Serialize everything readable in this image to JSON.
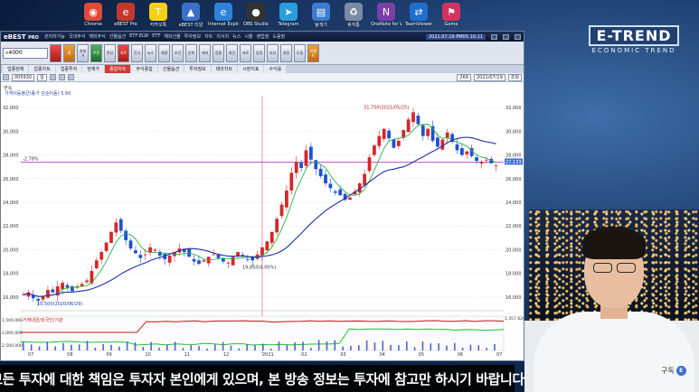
{
  "desktop": {
    "icons": [
      {
        "name": "chrome-icon",
        "label": "Chrome",
        "glyph": "◉",
        "color": "#e04a3a"
      },
      {
        "name": "ebest-icon",
        "label": "eBEST Pro",
        "glyph": "e",
        "color": "#c4382b"
      },
      {
        "name": "kakaotalk-icon",
        "label": "카카오톡",
        "glyph": "T",
        "color": "#f5d015"
      },
      {
        "name": "hts-icon",
        "label": "eBEST 티알",
        "glyph": "▲",
        "color": "#3c70c8"
      },
      {
        "name": "ie-icon",
        "label": "Internet Explorer",
        "glyph": "e",
        "color": "#2f83d8"
      },
      {
        "name": "obs-icon",
        "label": "OBS Studio",
        "glyph": "●",
        "color": "#333333"
      },
      {
        "name": "telegram-icon",
        "label": "Telegram",
        "glyph": "➤",
        "color": "#2a9ddb"
      },
      {
        "name": "folder-icon",
        "label": "탐색기",
        "glyph": "▤",
        "color": "#3c7bd0"
      },
      {
        "name": "recycle-icon",
        "label": "휴지통",
        "glyph": "♻",
        "color": "#7a8ba6"
      },
      {
        "name": "onenote-icon",
        "label": "OneNote for Windows",
        "glyph": "N",
        "color": "#7b3fa8"
      },
      {
        "name": "teamviewer-icon",
        "label": "TeamViewer",
        "glyph": "⇄",
        "color": "#1f6fd1"
      },
      {
        "name": "game-icon",
        "label": "Game",
        "glyph": "⚑",
        "color": "#d2345f"
      }
    ]
  },
  "logo": {
    "title": "E-TREND",
    "subtitle": "ECONOMIC TREND"
  },
  "app": {
    "brand": "eBEST",
    "brand_suffix": "PRO",
    "menus": [
      "관리자기능",
      "국내주식",
      "해외주식",
      "선물옵션",
      "ETF·ELW",
      "ETF",
      "해외선물",
      "투자정보",
      "차트",
      "리서치",
      "뉴스",
      "시황",
      "영업점",
      "도움말"
    ],
    "clock": "2021.07.19  PM05:10:11",
    "search_value": "4000",
    "toolbar_buttons": [
      {
        "name": "tb-logo-button",
        "label": "",
        "style": "red"
      },
      {
        "name": "tb-home-button",
        "label": "홈",
        "style": "orange"
      },
      {
        "name": "tb-current-button",
        "label": "현재가",
        "style": ""
      },
      {
        "name": "tb-order-button",
        "label": "주문",
        "style": "green"
      },
      {
        "name": "tb-interest-button",
        "label": "관심",
        "style": ""
      },
      {
        "name": "tb-chart-button",
        "label": "차트",
        "style": "red"
      },
      {
        "name": "tb-balance-button",
        "label": "잔고",
        "style": ""
      },
      {
        "name": "tb-news-button",
        "label": "뉴스",
        "style": ""
      },
      {
        "name": "tb-trade-button",
        "label": "체결",
        "style": ""
      },
      {
        "name": "tb-condition-button",
        "label": "조건",
        "style": ""
      },
      {
        "name": "tb-rank-button",
        "label": "순위",
        "style": ""
      },
      {
        "name": "tb-theme-button",
        "label": "테마",
        "style": ""
      },
      {
        "name": "tb-sector-button",
        "label": "업종",
        "style": ""
      },
      {
        "name": "tb-foreign-button",
        "label": "외인",
        "style": ""
      },
      {
        "name": "tb-program-button",
        "label": "프로",
        "style": ""
      },
      {
        "name": "tb-calendar-button",
        "label": "일정",
        "style": ""
      },
      {
        "name": "tb-research-button",
        "label": "리서",
        "style": ""
      },
      {
        "name": "tb-settings-button",
        "label": "설정",
        "style": ""
      },
      {
        "name": "tb-help-button",
        "label": "도움",
        "style": ""
      },
      {
        "name": "tb-event-button",
        "label": "이벤트",
        "style": "orange"
      }
    ],
    "tabs": [
      "업종현재",
      "업종차트",
      "업종투자",
      "현재가",
      "종합차트",
      "주식종합",
      "선물옵션",
      "투자정보",
      "테마차트",
      "시장지표",
      "수익률"
    ],
    "active_tab": "종합차트",
    "ctrl": {
      "code": "005930",
      "period": "일",
      "count": "269",
      "date": "2021/07/19",
      "button": "조회"
    }
  },
  "chart_data": {
    "type": "candlestick",
    "price_axis": {
      "ylim": [
        15000,
        33000
      ],
      "ticks": [
        "32,000",
        "30,000",
        "28,000",
        "26,000",
        "24,000",
        "22,000",
        "20,000",
        "18,000",
        "16,000"
      ]
    },
    "x_ticks": [
      "07",
      "08",
      "09",
      "10",
      "11",
      "12",
      "2021",
      "02",
      "03",
      "04",
      "05",
      "06",
      "07"
    ],
    "legend": "가격이동평균(종가 단순이동) 5 60",
    "hline": {
      "value": 27400,
      "left_label": "-2.78%",
      "right_label": "27,133"
    },
    "annotations": {
      "high": "31,750(2021/05/25)",
      "low": "15,500(2020/06/29)",
      "mid": "19,850(4.00%)"
    },
    "close": [
      16.2,
      16.4,
      15.9,
      15.7,
      16.1,
      16.6,
      16.4,
      16.9,
      17.2,
      16.8,
      16.5,
      16.9,
      17.1,
      17.4,
      18.2,
      19.1,
      19.8,
      20.6,
      21.5,
      22.3,
      21.6,
      20.8,
      20.1,
      19.7,
      19.3,
      19.6,
      20.2,
      20.0,
      19.5,
      19.2,
      19.5,
      19.8,
      20.1,
      19.8,
      19.4,
      19.0,
      18.8,
      19.1,
      19.4,
      19.6,
      19.3,
      19.0,
      18.9,
      19.4,
      19.8,
      19.5,
      19.2,
      19.1,
      19.6,
      20.2,
      20.7,
      21.5,
      22.6,
      23.8,
      25.0,
      26.5,
      27.4,
      26.9,
      28.4,
      27.6,
      26.8,
      26.2,
      25.6,
      25.2,
      24.8,
      24.6,
      24.2,
      24.4,
      24.9,
      25.6,
      26.4,
      27.8,
      28.8,
      29.6,
      30.2,
      29.4,
      28.6,
      29.2,
      30.1,
      31.0,
      31.6,
      30.6,
      29.6,
      30.2,
      29.2,
      28.7,
      29.3,
      29.9,
      29.1,
      28.4,
      28.0,
      28.3,
      27.9,
      27.5,
      27.4,
      27.6,
      27.3,
      27.1
    ],
    "volume_note": "volume histogram in bottom panel",
    "sub_panel": {
      "ticks": [
        "1,500,000",
        "2,000,000",
        "2,500,000"
      ],
      "legend": "거래대금/외국인/기관",
      "right_label": "1,357,620"
    }
  },
  "disclaimer": "모든 투자에 대한 책임은 투자자 본인에게 있으며, 본 방송 정보는 투자에 참고만 하시기 바랍니다",
  "subscribe": {
    "label": "구독",
    "badge": "E"
  }
}
